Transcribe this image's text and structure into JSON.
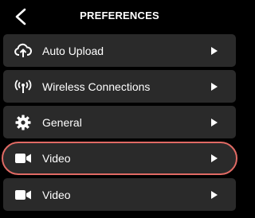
{
  "header": {
    "title": "PREFERENCES",
    "back_icon": "chevron-left-icon"
  },
  "menu": {
    "items": [
      {
        "label": "Auto Upload",
        "icon": "cloud-upload-icon"
      },
      {
        "label": "Wireless Connections",
        "icon": "wireless-signal-icon"
      },
      {
        "label": "General",
        "icon": "gear-icon"
      },
      {
        "label": "Video",
        "icon": "video-camera-icon",
        "highlighted": true
      },
      {
        "label": "Video",
        "icon": "video-camera-icon"
      }
    ]
  },
  "colors": {
    "background": "#000000",
    "row_background": "#2a2a2a",
    "highlight_outline": "#e06a64",
    "text": "#ffffff"
  }
}
